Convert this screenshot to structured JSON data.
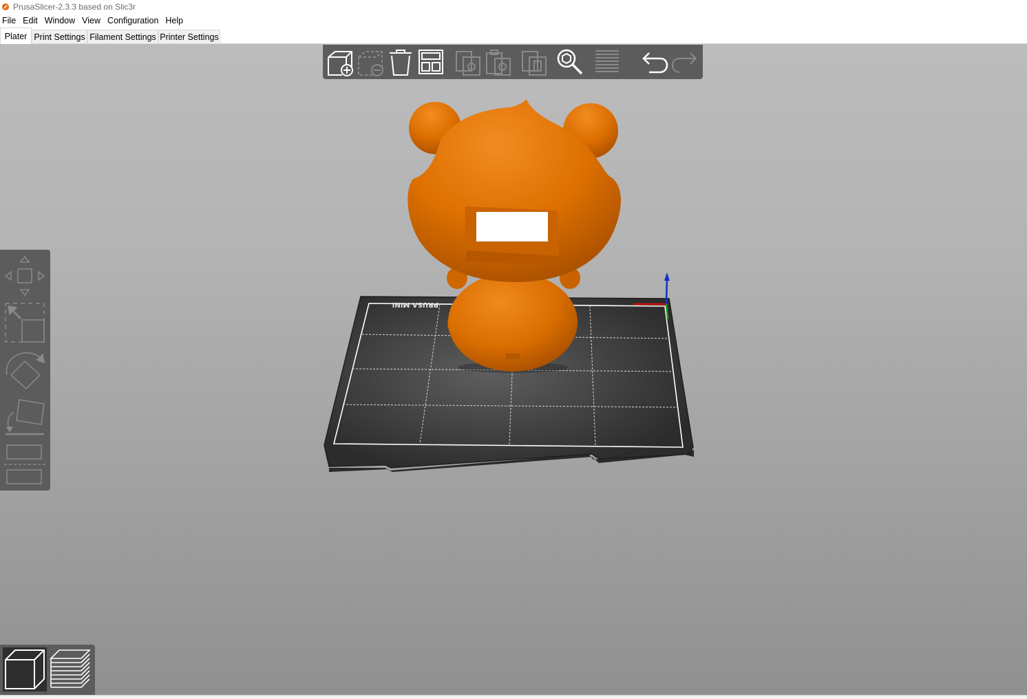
{
  "window": {
    "title": "PrusaSlicer-2.3.3 based on Slic3r",
    "logo_icon": "prusaslicer-logo-icon"
  },
  "menu": {
    "items": [
      "File",
      "Edit",
      "Window",
      "View",
      "Configuration",
      "Help"
    ]
  },
  "tabs": [
    {
      "label": "Plater",
      "active": true
    },
    {
      "label": "Print Settings",
      "active": false
    },
    {
      "label": "Filament Settings",
      "active": false
    },
    {
      "label": "Printer Settings",
      "active": false
    }
  ],
  "top_toolbar": {
    "buttons": [
      {
        "icon": "add-object-icon",
        "enabled": true
      },
      {
        "icon": "delete-object-icon",
        "enabled": false
      },
      {
        "icon": "delete-all-icon",
        "enabled": true
      },
      {
        "icon": "arrange-icon",
        "enabled": true
      },
      {
        "icon": "copy-icon",
        "enabled": false
      },
      {
        "icon": "paste-icon",
        "enabled": false
      },
      {
        "icon": "instances-icon",
        "enabled": false
      },
      {
        "icon": "search-icon",
        "enabled": true
      },
      {
        "icon": "layers-editing-icon",
        "enabled": true
      },
      {
        "icon": "undo-icon",
        "enabled": true
      },
      {
        "icon": "redo-icon",
        "enabled": false
      }
    ]
  },
  "left_toolbar": {
    "tools": [
      "move-icon",
      "scale-icon",
      "rotate-icon",
      "place-on-face-icon",
      "cut-icon"
    ]
  },
  "view_toolbar": {
    "buttons": [
      {
        "icon": "3d-view-icon",
        "active": true
      },
      {
        "icon": "preview-icon",
        "active": false
      }
    ]
  },
  "scene": {
    "bed_label": "PRUSA MINI",
    "model_color": "#e07000",
    "bed_color": "#3a3a3a",
    "bed_outline_color": "#ffffff"
  },
  "colors": {
    "toolbar_bg": "#5c5c5c",
    "icon_enabled": "#ffffff",
    "icon_disabled": "#8a8a8a"
  }
}
